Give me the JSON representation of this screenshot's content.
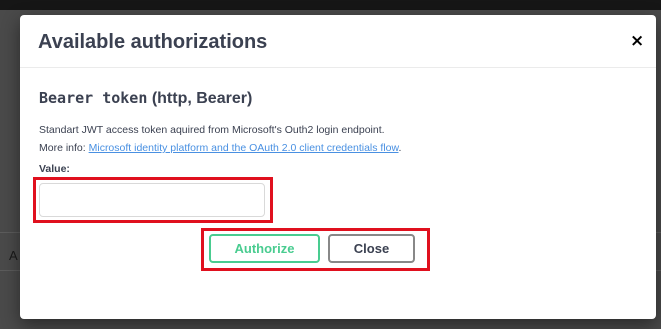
{
  "backdrop": {
    "fragment": "A"
  },
  "modal": {
    "title": "Available authorizations",
    "close_glyph": "×"
  },
  "scheme": {
    "name": "Bearer token",
    "type": "(http, Bearer)",
    "description": "Standart JWT access token aquired from Microsoft's Outh2 login endpoint.",
    "more_info_prefix": "More info:",
    "more_info_link": "Microsoft identity platform and the OAuth 2.0 client credentials flow",
    "more_info_suffix": "."
  },
  "form": {
    "value_label": "Value:",
    "value": ""
  },
  "buttons": {
    "authorize": "Authorize",
    "close": "Close"
  },
  "colors": {
    "highlight": "#e0101e",
    "authorize_accent": "#49cc90",
    "link": "#4990e2",
    "text": "#3b4151"
  },
  "icons": {
    "close": "close-icon"
  }
}
